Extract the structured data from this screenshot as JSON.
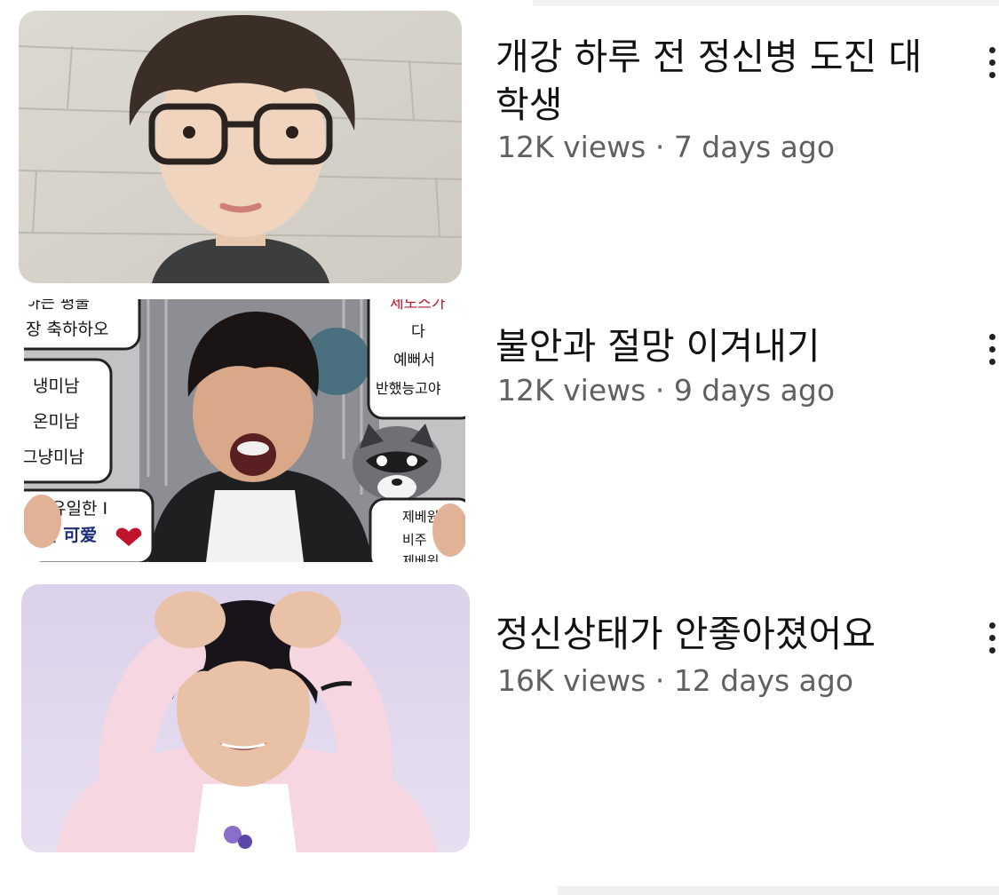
{
  "videos": [
    {
      "title": "개강 하루 전 정신병 도진 대학생",
      "views": "12K views",
      "separator": "·",
      "age": "7 days ago",
      "thumbnail_subject": "photo of a young man with glasses"
    },
    {
      "title": "불안과 절망 이겨내기",
      "views": "12K views",
      "separator": "·",
      "age": "9 days ago",
      "thumbnail_subject": "photo of a young man shouting in front of fan banners",
      "thumbnail_texts": {
        "left": [
          "하는 평물",
          "장 축하하오",
          "냉미남",
          "온미남",
          "그냥미남",
          "유일한 I",
          "이 可爱"
        ],
        "right": [
          "제노스가",
          "다",
          "예뻐서",
          "반했능고야",
          "제베원",
          "비주",
          "제베원"
        ]
      }
    },
    {
      "title": "정신상태가 안좋아졌어요",
      "views": "16K views",
      "separator": "·",
      "age": "12 days ago",
      "thumbnail_subject": "photo of a young man holding his head"
    }
  ],
  "colors": {
    "title": "#111111",
    "meta": "#606060",
    "background": "#ffffff"
  },
  "icons": [
    "more-vert-icon"
  ]
}
